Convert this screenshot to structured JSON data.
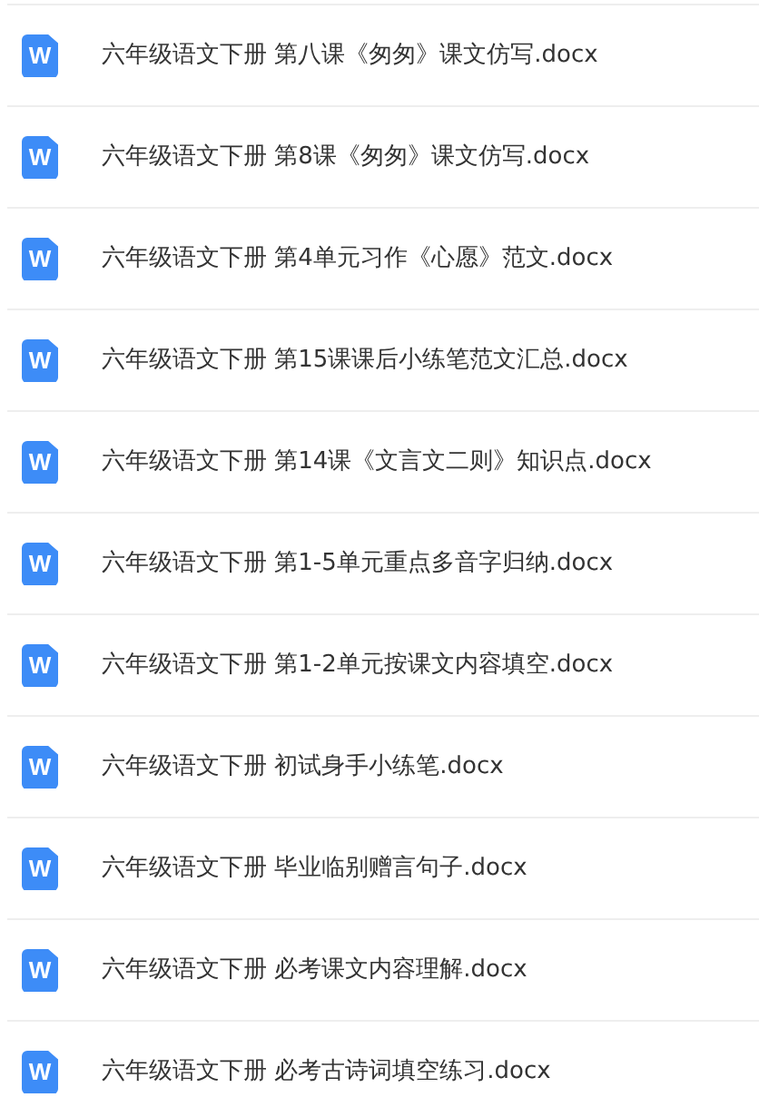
{
  "files": [
    {
      "badge": "W",
      "name": "六年级语文下册 第八课《匆匆》课文仿写.docx"
    },
    {
      "badge": "W",
      "name": "六年级语文下册 第8课《匆匆》课文仿写.docx"
    },
    {
      "badge": "W",
      "name": "六年级语文下册 第4单元习作《心愿》范文.docx"
    },
    {
      "badge": "W",
      "name": "六年级语文下册 第15课课后小练笔范文汇总.docx"
    },
    {
      "badge": "W",
      "name": "六年级语文下册 第14课《文言文二则》知识点.docx"
    },
    {
      "badge": "W",
      "name": "六年级语文下册 第1-5单元重点多音字归纳.docx"
    },
    {
      "badge": "W",
      "name": "六年级语文下册 第1-2单元按课文内容填空.docx"
    },
    {
      "badge": "W",
      "name": "六年级语文下册 初试身手小练笔.docx"
    },
    {
      "badge": "W",
      "name": "六年级语文下册 毕业临别赠言句子.docx"
    },
    {
      "badge": "W",
      "name": "六年级语文下册 必考课文内容理解.docx"
    },
    {
      "badge": "W",
      "name": "六年级语文下册 必考古诗词填空练习.docx"
    }
  ]
}
